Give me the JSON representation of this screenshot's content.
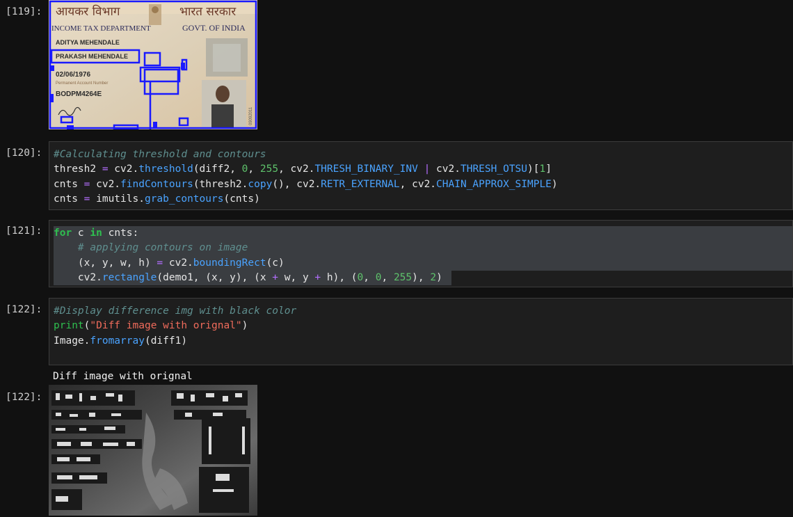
{
  "cells": [
    {
      "prompt": "[119]:"
    },
    {
      "prompt": "[120]:",
      "lines": [
        "#Calculating threshold and contours",
        "thresh2 = cv2.threshold(diff2, 0, 255, cv2.THRESH_BINARY_INV | cv2.THRESH_OTSU)[1]",
        "cnts = cv2.findContours(thresh2.copy(), cv2.RETR_EXTERNAL, cv2.CHAIN_APPROX_SIMPLE)",
        "cnts = imutils.grab_contours(cnts)"
      ]
    },
    {
      "prompt": "[121]:",
      "lines": [
        "for c in cnts:",
        "    # applying contours on image",
        "    (x, y, w, h) = cv2.boundingRect(c)",
        "    cv2.rectangle(demo1, (x, y), (x + w, y + h), (0, 0, 255), 2)"
      ]
    },
    {
      "prompt": "[122]:",
      "lines": [
        "#Display difference img with black color",
        "print(\"Diff image with orignal\")",
        "Image.fromarray(diff1)"
      ]
    },
    {
      "prompt": "[122]:",
      "output_text": "Diff image with orignal"
    }
  ],
  "pan_card": {
    "hindi_left": "आयकर विभाग",
    "hindi_right": "भारत सरकार",
    "dept": "INCOME TAX DEPARTMENT",
    "govt": "GOVT. OF INDIA",
    "name": "ADITYA MEHENDALE",
    "father": "PRAKASH MEHENDALE",
    "dob": "02/06/1976",
    "pan_label": "Permanent Account Number",
    "pan": "BODPM4264E",
    "side_code": "09092011"
  },
  "colors": {
    "background": "#111111",
    "cell_bg": "#1e1e1e",
    "comment": "#5f8f8f",
    "keyword": "#2fbf4f",
    "function": "#4aa3ff",
    "number": "#5ec26b",
    "string": "#ef6b5b",
    "contour_box": "#1a1aff"
  },
  "icons": [
    "emblem-icon",
    "hologram-icon",
    "portrait-photo",
    "signature-mark"
  ]
}
